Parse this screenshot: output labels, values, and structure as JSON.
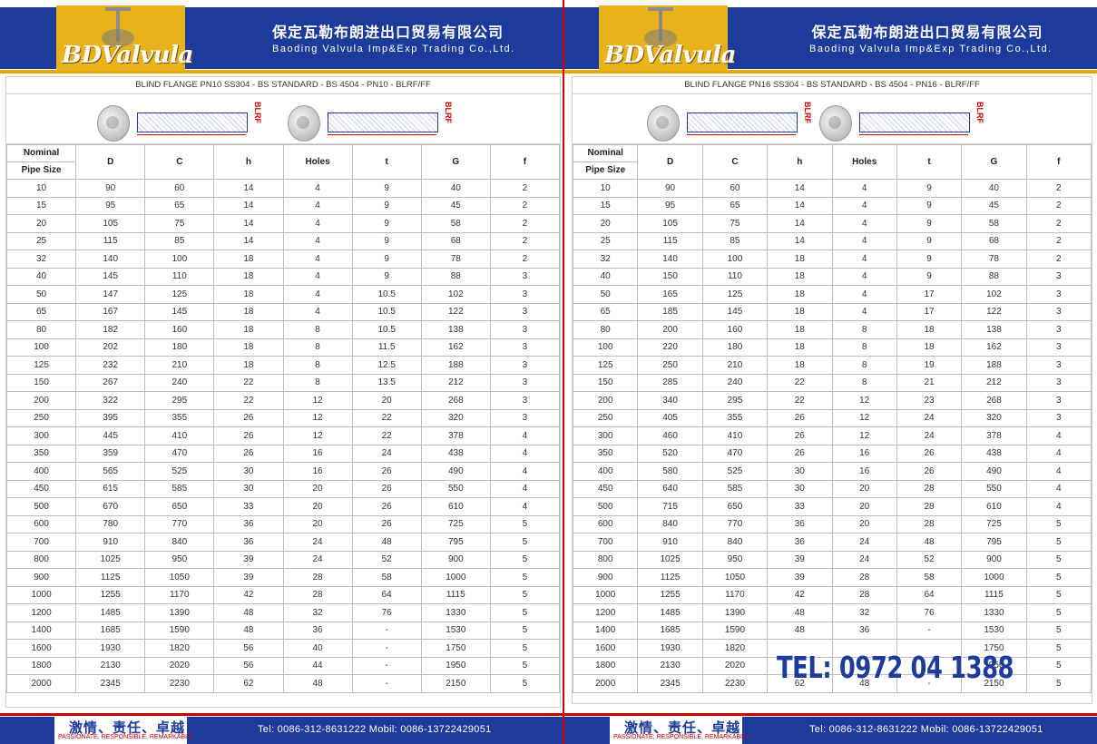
{
  "company": {
    "name_cn": "保定瓦勒布朗进出口贸易有限公司",
    "name_en": "Baoding Valvula Imp&Exp Trading Co.,Ltd.",
    "logo_text": "BDValvula"
  },
  "footer": {
    "slogan_cn": "激情、责任、卓越",
    "slogan_en": "PASSIONATE, RESPONSIBLE, REMARKABLE",
    "contact": "Tel: 0086-312-8631222   Mobil: 0086-13722429051"
  },
  "watermark": "TEL: 0972 04 1388",
  "colors": {
    "brand_blue": "#1d3b9a",
    "logo_gold": "#e8b21a",
    "accent_red": "#cc0000"
  },
  "headers": {
    "nominal_line1": "Nominal",
    "nominal_line2": "Pipe Size",
    "cols": [
      "D",
      "C",
      "h",
      "Holes",
      "t",
      "G",
      "f"
    ]
  },
  "drawing_tag": "BLRF",
  "left": {
    "title": "BLIND FLANGE PN10 SS304 - BS STANDARD - BS 4504 - PN10 - BLRF/FF",
    "rows": [
      [
        "10",
        "90",
        "60",
        "14",
        "4",
        "9",
        "40",
        "2"
      ],
      [
        "15",
        "95",
        "65",
        "14",
        "4",
        "9",
        "45",
        "2"
      ],
      [
        "20",
        "105",
        "75",
        "14",
        "4",
        "9",
        "58",
        "2"
      ],
      [
        "25",
        "115",
        "85",
        "14",
        "4",
        "9",
        "68",
        "2"
      ],
      [
        "32",
        "140",
        "100",
        "18",
        "4",
        "9",
        "78",
        "2"
      ],
      [
        "40",
        "145",
        "110",
        "18",
        "4",
        "9",
        "88",
        "3"
      ],
      [
        "50",
        "147",
        "125",
        "18",
        "4",
        "10.5",
        "102",
        "3"
      ],
      [
        "65",
        "167",
        "145",
        "18",
        "4",
        "10.5",
        "122",
        "3"
      ],
      [
        "80",
        "182",
        "160",
        "18",
        "8",
        "10.5",
        "138",
        "3"
      ],
      [
        "100",
        "202",
        "180",
        "18",
        "8",
        "11.5",
        "162",
        "3"
      ],
      [
        "125",
        "232",
        "210",
        "18",
        "8",
        "12.5",
        "188",
        "3"
      ],
      [
        "150",
        "267",
        "240",
        "22",
        "8",
        "13.5",
        "212",
        "3"
      ],
      [
        "200",
        "322",
        "295",
        "22",
        "12",
        "20",
        "268",
        "3"
      ],
      [
        "250",
        "395",
        "355",
        "26",
        "12",
        "22",
        "320",
        "3"
      ],
      [
        "300",
        "445",
        "410",
        "26",
        "12",
        "22",
        "378",
        "4"
      ],
      [
        "350",
        "359",
        "470",
        "26",
        "16",
        "24",
        "438",
        "4"
      ],
      [
        "400",
        "565",
        "525",
        "30",
        "16",
        "26",
        "490",
        "4"
      ],
      [
        "450",
        "615",
        "585",
        "30",
        "20",
        "26",
        "550",
        "4"
      ],
      [
        "500",
        "670",
        "650",
        "33",
        "20",
        "26",
        "610",
        "4"
      ],
      [
        "600",
        "780",
        "770",
        "36",
        "20",
        "26",
        "725",
        "5"
      ],
      [
        "700",
        "910",
        "840",
        "36",
        "24",
        "48",
        "795",
        "5"
      ],
      [
        "800",
        "1025",
        "950",
        "39",
        "24",
        "52",
        "900",
        "5"
      ],
      [
        "900",
        "1125",
        "1050",
        "39",
        "28",
        "58",
        "1000",
        "5"
      ],
      [
        "1000",
        "1255",
        "1170",
        "42",
        "28",
        "64",
        "1115",
        "5"
      ],
      [
        "1200",
        "1485",
        "1390",
        "48",
        "32",
        "76",
        "1330",
        "5"
      ],
      [
        "1400",
        "1685",
        "1590",
        "48",
        "36",
        "-",
        "1530",
        "5"
      ],
      [
        "1600",
        "1930",
        "1820",
        "56",
        "40",
        "-",
        "1750",
        "5"
      ],
      [
        "1800",
        "2130",
        "2020",
        "56",
        "44",
        "-",
        "1950",
        "5"
      ],
      [
        "2000",
        "2345",
        "2230",
        "62",
        "48",
        "-",
        "2150",
        "5"
      ]
    ]
  },
  "right": {
    "title": "BLIND FLANGE PN16 SS304 - BS STANDARD - BS 4504 - PN16 - BLRF/FF",
    "rows": [
      [
        "10",
        "90",
        "60",
        "14",
        "4",
        "9",
        "40",
        "2"
      ],
      [
        "15",
        "95",
        "65",
        "14",
        "4",
        "9",
        "45",
        "2"
      ],
      [
        "20",
        "105",
        "75",
        "14",
        "4",
        "9",
        "58",
        "2"
      ],
      [
        "25",
        "115",
        "85",
        "14",
        "4",
        "9",
        "68",
        "2"
      ],
      [
        "32",
        "140",
        "100",
        "18",
        "4",
        "9",
        "78",
        "2"
      ],
      [
        "40",
        "150",
        "110",
        "18",
        "4",
        "9",
        "88",
        "3"
      ],
      [
        "50",
        "165",
        "125",
        "18",
        "4",
        "17",
        "102",
        "3"
      ],
      [
        "65",
        "185",
        "145",
        "18",
        "4",
        "17",
        "122",
        "3"
      ],
      [
        "80",
        "200",
        "160",
        "18",
        "8",
        "18",
        "138",
        "3"
      ],
      [
        "100",
        "220",
        "180",
        "18",
        "8",
        "18",
        "162",
        "3"
      ],
      [
        "125",
        "250",
        "210",
        "18",
        "8",
        "19",
        "188",
        "3"
      ],
      [
        "150",
        "285",
        "240",
        "22",
        "8",
        "21",
        "212",
        "3"
      ],
      [
        "200",
        "340",
        "295",
        "22",
        "12",
        "23",
        "268",
        "3"
      ],
      [
        "250",
        "405",
        "355",
        "26",
        "12",
        "24",
        "320",
        "3"
      ],
      [
        "300",
        "460",
        "410",
        "26",
        "12",
        "24",
        "378",
        "4"
      ],
      [
        "350",
        "520",
        "470",
        "26",
        "16",
        "26",
        "438",
        "4"
      ],
      [
        "400",
        "580",
        "525",
        "30",
        "16",
        "26",
        "490",
        "4"
      ],
      [
        "450",
        "640",
        "585",
        "30",
        "20",
        "28",
        "550",
        "4"
      ],
      [
        "500",
        "715",
        "650",
        "33",
        "20",
        "28",
        "610",
        "4"
      ],
      [
        "600",
        "840",
        "770",
        "36",
        "20",
        "28",
        "725",
        "5"
      ],
      [
        "700",
        "910",
        "840",
        "36",
        "24",
        "48",
        "795",
        "5"
      ],
      [
        "800",
        "1025",
        "950",
        "39",
        "24",
        "52",
        "900",
        "5"
      ],
      [
        "900",
        "1125",
        "1050",
        "39",
        "28",
        "58",
        "1000",
        "5"
      ],
      [
        "1000",
        "1255",
        "1170",
        "42",
        "28",
        "64",
        "1115",
        "5"
      ],
      [
        "1200",
        "1485",
        "1390",
        "48",
        "32",
        "76",
        "1330",
        "5"
      ],
      [
        "1400",
        "1685",
        "1590",
        "48",
        "36",
        "-",
        "1530",
        "5"
      ],
      [
        "1600",
        "1930",
        "1820",
        "",
        "",
        "",
        "1750",
        "5"
      ],
      [
        "1800",
        "2130",
        "2020",
        "",
        "",
        "",
        "1950",
        "5"
      ],
      [
        "2000",
        "2345",
        "2230",
        "62",
        "48",
        "-",
        "2150",
        "5"
      ]
    ]
  }
}
